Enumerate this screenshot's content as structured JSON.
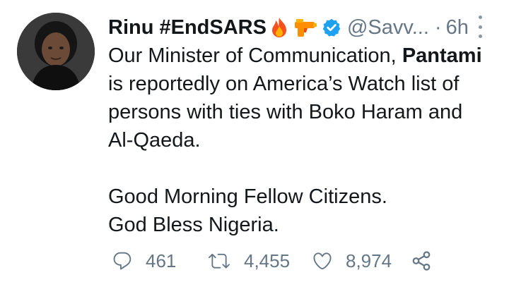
{
  "tweet": {
    "display_name": "Rinu #EndSARS",
    "handle": "@Savv...",
    "separator": "·",
    "time": "6h",
    "emojis": [
      "fire-emoji",
      "water-pistol-emoji"
    ],
    "verified": true,
    "body_line1_prefix": "Our Minister of Communication, ",
    "body_line1_mention": "Pantami",
    "body_line2": "is reportedly on America’s Watch list of",
    "body_line3": "persons with ties with Boko Haram and",
    "body_line4": "Al-Qaeda.",
    "body_line5": "Good Morning Fellow Citizens.",
    "body_line6": "God Bless Nigeria."
  },
  "actions": {
    "replies": "461",
    "retweets": "4,455",
    "likes": "8,974",
    "icons": [
      "reply-icon",
      "retweet-icon",
      "like-icon",
      "share-icon"
    ]
  },
  "colors": {
    "text": "#14171a",
    "secondary": "#657786",
    "verified": "#1da1f2",
    "background": "#ffffff"
  }
}
